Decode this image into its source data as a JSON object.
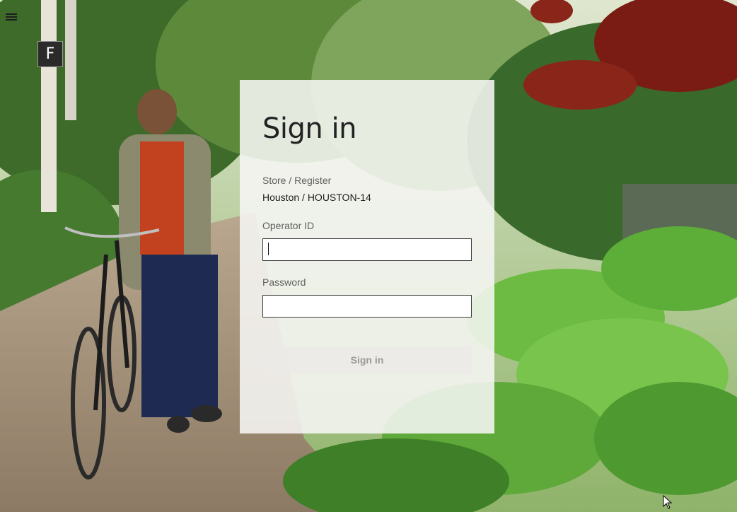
{
  "app": {
    "logo_letter": "F"
  },
  "signin": {
    "title": "Sign in",
    "store_label": "Store / Register",
    "store_value": "Houston / HOUSTON-14",
    "operator_label": "Operator ID",
    "operator_value": "",
    "password_label": "Password",
    "password_value": "",
    "button_label": "Sign in"
  },
  "icons": {
    "menu": "hamburger-menu",
    "cursor": "arrow-pointer"
  },
  "colors": {
    "panel": "#f6f6f4",
    "button_disabled_text": "#9a9a9a",
    "field_border": "#3c3c3c"
  }
}
